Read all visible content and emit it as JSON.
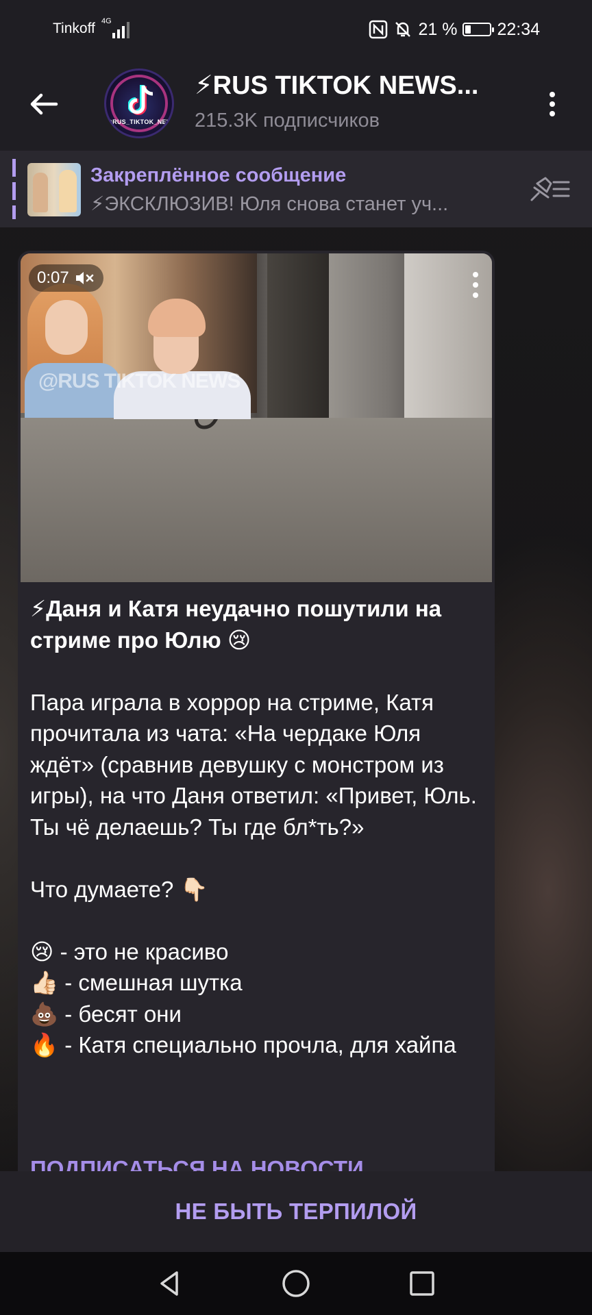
{
  "status_bar": {
    "carrier": "Tinkoff",
    "network": "4G",
    "battery_text": "21 %",
    "battery_level": 0.21,
    "time": "22:34"
  },
  "header": {
    "title": "⚡RUS TIKTOK NEWS...",
    "subtitle": "215.3K подписчиков",
    "avatar_text": "@RUS_TIKTOK_NEWS"
  },
  "pinned": {
    "label": "Закреплённое сообщение",
    "text": "⚡ЭКСКЛЮЗИВ! Юля снова станет уч..."
  },
  "video": {
    "duration": "0:07",
    "watermark": "@RUS TIKTOK NEWS"
  },
  "message": {
    "title": "⚡Даня и Катя неудачно пошутили на стриме про Юлю 😢",
    "body": "Пара играла в хоррор на стриме, Катя прочитала из чата: «На чердаке Юля ждёт» (сравнив девушку с монстром из игры), на что Даня ответил: «Привет, Юль. Ты чё делаешь? Ты где бл*ть?»",
    "question": "Что думаете? 👇🏻",
    "options": [
      "😢 - это не красиво",
      "👍🏻 - смешная шутка",
      "💩 - бесят они",
      "🔥 - Катя специально прочла, для хайпа"
    ],
    "link": "ПОДПИСАТЬСЯ НА НОВОСТИ"
  },
  "action_bar": {
    "button_label": "НЕ БЫТЬ ТЕРПИЛОЙ"
  },
  "colors": {
    "accent": "#b39df0",
    "bubble": "#27252c",
    "header": "#1f1e23"
  }
}
